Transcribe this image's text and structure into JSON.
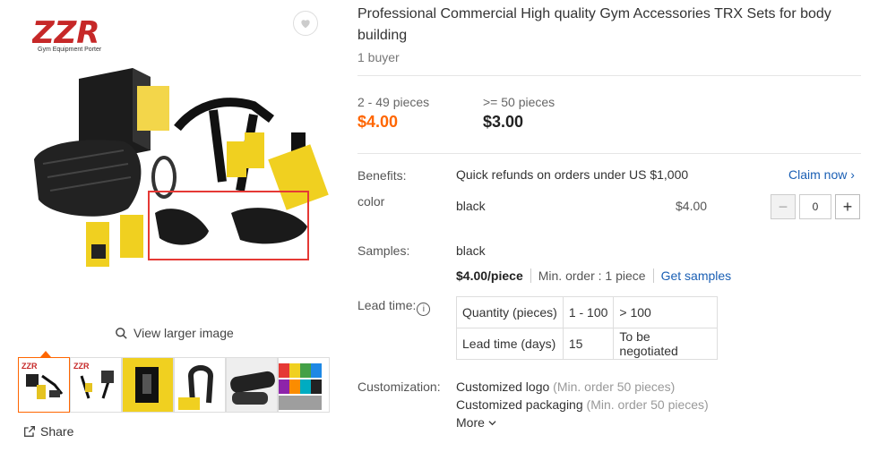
{
  "logo": {
    "text": "ZZR",
    "subtitle": "Gym Equipment Porter"
  },
  "gallery": {
    "view_larger": "View larger image",
    "share": "Share",
    "thumbnails": [
      "thumb-1",
      "thumb-2",
      "thumb-3",
      "thumb-4",
      "thumb-5",
      "thumb-6"
    ]
  },
  "product": {
    "title": "Professional Commercial High quality Gym Accessories TRX Sets for body building",
    "buyers": "1 buyer"
  },
  "pricing": {
    "tiers": [
      {
        "range": "2 - 49 pieces",
        "price": "$4.00"
      },
      {
        "range": ">= 50 pieces",
        "price": "$3.00"
      }
    ]
  },
  "benefits": {
    "label": "Benefits:",
    "text": "Quick refunds on orders under US $1,000",
    "claim": "Claim now"
  },
  "color": {
    "label": "color",
    "value": "black",
    "price": "$4.00",
    "quantity": "0"
  },
  "samples": {
    "label": "Samples:",
    "value": "black",
    "price": "$4.00/piece",
    "min_order": "Min. order : 1 piece",
    "get_samples": "Get samples"
  },
  "lead_time": {
    "label": "Lead time:",
    "rows": [
      [
        "Quantity (pieces)",
        "1 - 100",
        "> 100"
      ],
      [
        "Lead time (days)",
        "15",
        "To be negotiated"
      ]
    ]
  },
  "customization": {
    "label": "Customization:",
    "items": [
      {
        "name": "Customized logo",
        "note": "(Min. order 50 pieces)"
      },
      {
        "name": "Customized packaging",
        "note": "(Min. order 50 pieces)"
      }
    ],
    "more": "More"
  },
  "colors": {
    "accent": "#ff6600",
    "link": "#1a5fb4",
    "highlight_box": "#e53935"
  }
}
